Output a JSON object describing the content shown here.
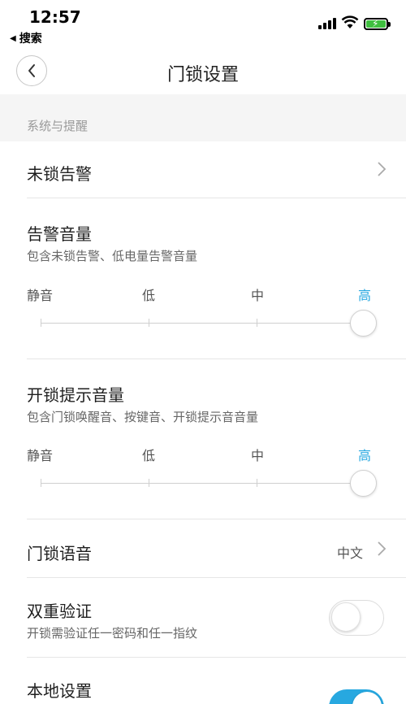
{
  "status_bar": {
    "time": "12:57",
    "back_app": "搜索",
    "signal_icon": "signal-bars-icon",
    "wifi_icon": "wifi-icon",
    "battery_icon": "battery-charging-icon",
    "battery_color": "#3fbf3f"
  },
  "nav": {
    "title": "门锁设置",
    "back_icon": "chevron-left-icon"
  },
  "section": {
    "header": "系统与提醒"
  },
  "unlock_alarm": {
    "label": "未锁告警"
  },
  "alarm_volume": {
    "title": "告警音量",
    "subtitle": "包含未锁告警、低电量告警音量",
    "levels": [
      "静音",
      "低",
      "中",
      "高"
    ],
    "selected": "高"
  },
  "unlock_volume": {
    "title": "开锁提示音量",
    "subtitle": "包含门锁唤醒音、按键音、开锁提示音音量",
    "levels": [
      "静音",
      "低",
      "中",
      "高"
    ],
    "selected": "高"
  },
  "lock_voice": {
    "label": "门锁语音",
    "value": "中文"
  },
  "dual_auth": {
    "title": "双重验证",
    "subtitle": "开锁需验证任一密码和任一指纹",
    "enabled": false
  },
  "local_settings": {
    "title": "本地设置",
    "enabled": true
  },
  "colors": {
    "accent": "#27a8e0",
    "section_bg": "#f5f5f5",
    "divider": "#e6e6e6"
  }
}
